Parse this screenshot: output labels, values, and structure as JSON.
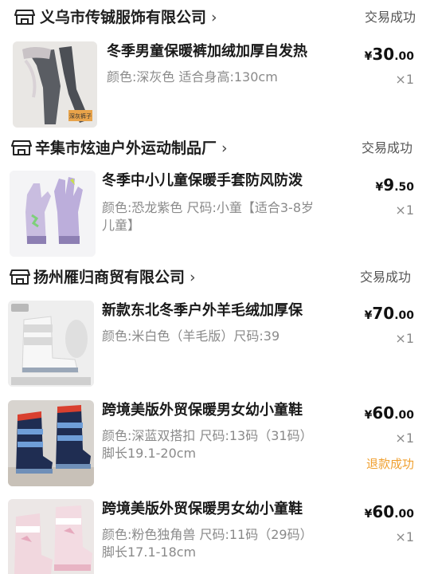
{
  "icon": "store-icon",
  "colors": {
    "refund": "#f0a030",
    "status": "#555555",
    "spec": "#8a8a8a"
  },
  "shops": [
    {
      "name": "义乌市传铖服饰有限公司",
      "status": "交易成功",
      "items": [
        {
          "title": "冬季男童保暖裤加绒加厚自发热",
          "spec": "颜色:深灰色 适合身高:130cm",
          "price_symbol": "¥",
          "price_int": "30",
          "price_dec": ".00",
          "qty": "×1",
          "thumb_label": "深灰裤子"
        }
      ]
    },
    {
      "name": "辛集市炫迪户外运动制品厂",
      "status": "交易成功",
      "items": [
        {
          "title": "冬季中小儿童保暖手套防风防泼",
          "spec": "颜色:恐龙紫色 尺码:小童【适合3-8岁儿童】",
          "price_symbol": "¥",
          "price_int": "9",
          "price_dec": ".50",
          "qty": "×1"
        }
      ]
    },
    {
      "name": "扬州雁归商贸有限公司",
      "status": "交易成功",
      "items": [
        {
          "title": "新款东北冬季户外羊毛绒加厚保",
          "spec": "颜色:米白色（羊毛版）尺码:39",
          "price_symbol": "¥",
          "price_int": "70",
          "price_dec": ".00",
          "qty": "×1"
        },
        {
          "title": "跨境美版外贸保暖男女幼小童鞋",
          "spec": "颜色:深蓝双搭扣 尺码:13码（31码）脚长19.1-20cm",
          "price_symbol": "¥",
          "price_int": "60",
          "price_dec": ".00",
          "qty": "×1",
          "refund": "退款成功"
        },
        {
          "title": "跨境美版外贸保暖男女幼小童鞋",
          "spec": "颜色:粉色独角兽 尺码:11码（29码）脚长17.1-18cm",
          "price_symbol": "¥",
          "price_int": "60",
          "price_dec": ".00",
          "qty": "×1"
        }
      ]
    }
  ]
}
